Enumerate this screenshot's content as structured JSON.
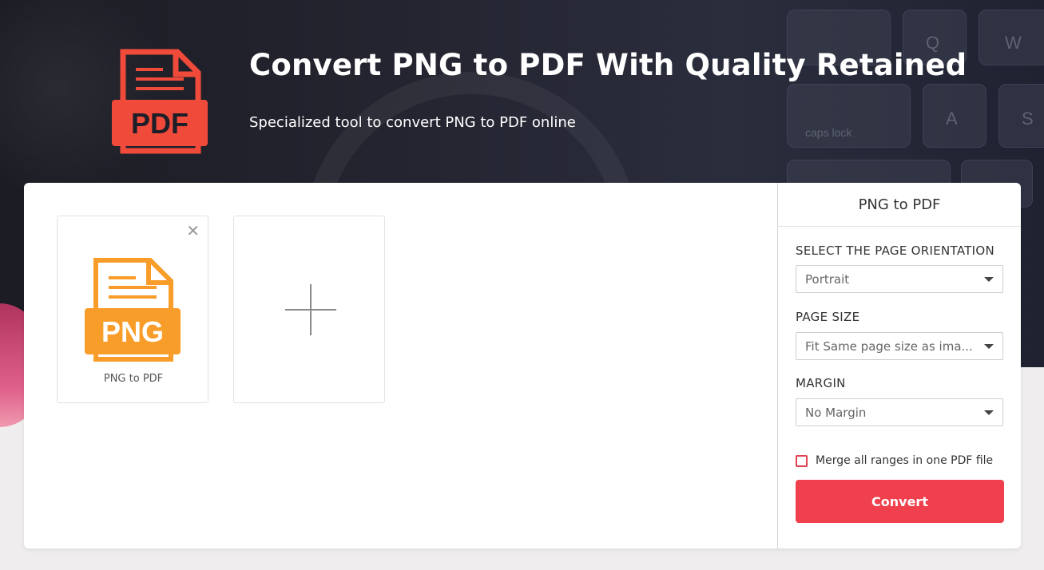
{
  "hero": {
    "title": "Convert PNG to PDF With Quality Retained",
    "subtitle": "Specialized tool to convert PNG to PDF online",
    "logo_icon": "pdf-document-icon",
    "logo_text": "PDF",
    "keys": [
      "Q",
      "W",
      "A",
      "S",
      "caps lock"
    ]
  },
  "files": [
    {
      "name": "PNG to PDF",
      "icon": "png-document-icon",
      "icon_text": "PNG"
    }
  ],
  "add_card": {
    "icon": "plus-icon"
  },
  "sidebar": {
    "title": "PNG to PDF",
    "orientation_label": "SELECT THE PAGE ORIENTATION",
    "orientation_value": "Portrait",
    "page_size_label": "PAGE SIZE",
    "page_size_value": "Fit Same page size as ima...",
    "margin_label": "MARGIN",
    "margin_value": "No Margin",
    "merge_label": "Merge all ranges in one PDF file",
    "merge_checked": false,
    "convert_label": "Convert"
  },
  "colors": {
    "accent": "#f0404d",
    "pdf_icon": "#f04b3a",
    "png_icon": "#f99d2a"
  }
}
